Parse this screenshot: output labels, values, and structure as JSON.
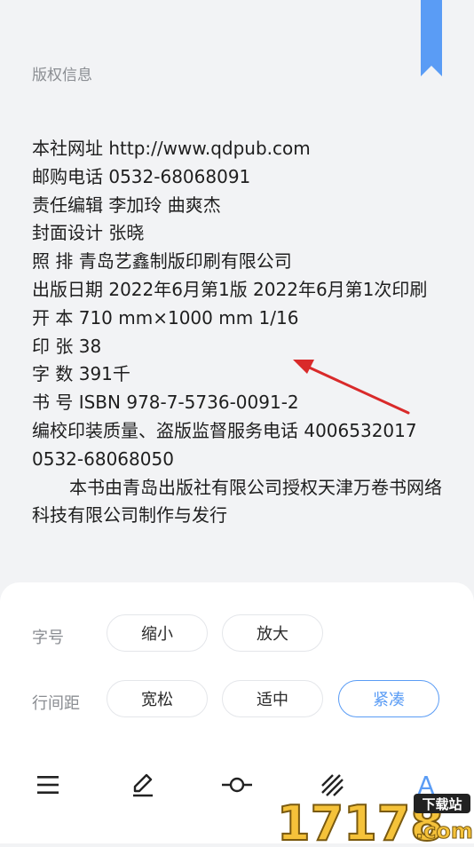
{
  "page": {
    "section_title": "版权信息",
    "lines": [
      "本社网址 http://www.qdpub.com",
      "邮购电话 0532-68068091",
      "责任编辑 李加玲 曲爽杰",
      "封面设计 张晓",
      "照 排 青岛艺鑫制版印刷有限公司",
      "出版日期  2022年6月第1版  2022年6月第1次印刷",
      "开 本 710 mm×1000 mm 1/16",
      "印 张 38",
      "字 数 391千",
      "书 号 ISBN 978-7-5736-0091-2",
      "编校印装质量、盗版监督服务电话 4006532017 0532-68068050",
      "本书由青岛出版社有限公司授权天津万卷书网络科技有限公司制作与发行"
    ]
  },
  "settings": {
    "font_size_label": "字号",
    "shrink_label": "缩小",
    "enlarge_label": "放大",
    "line_spacing_label": "行间距",
    "loose_label": "宽松",
    "medium_label": "适中",
    "compact_label": "紧凑",
    "active_option": "紧凑"
  },
  "toolbar": {
    "icons": [
      "menu-icon",
      "pencil-icon",
      "progress-icon",
      "brightness-icon",
      "font-icon"
    ],
    "font_icon_glyph": "A"
  },
  "watermark": {
    "main": "17178",
    "tag": "下载站",
    "domain": ".com"
  },
  "colors": {
    "accent": "#5a9cf5",
    "arrow": "#d92a2a",
    "background": "#f2f3f5",
    "panel": "#ffffff"
  }
}
